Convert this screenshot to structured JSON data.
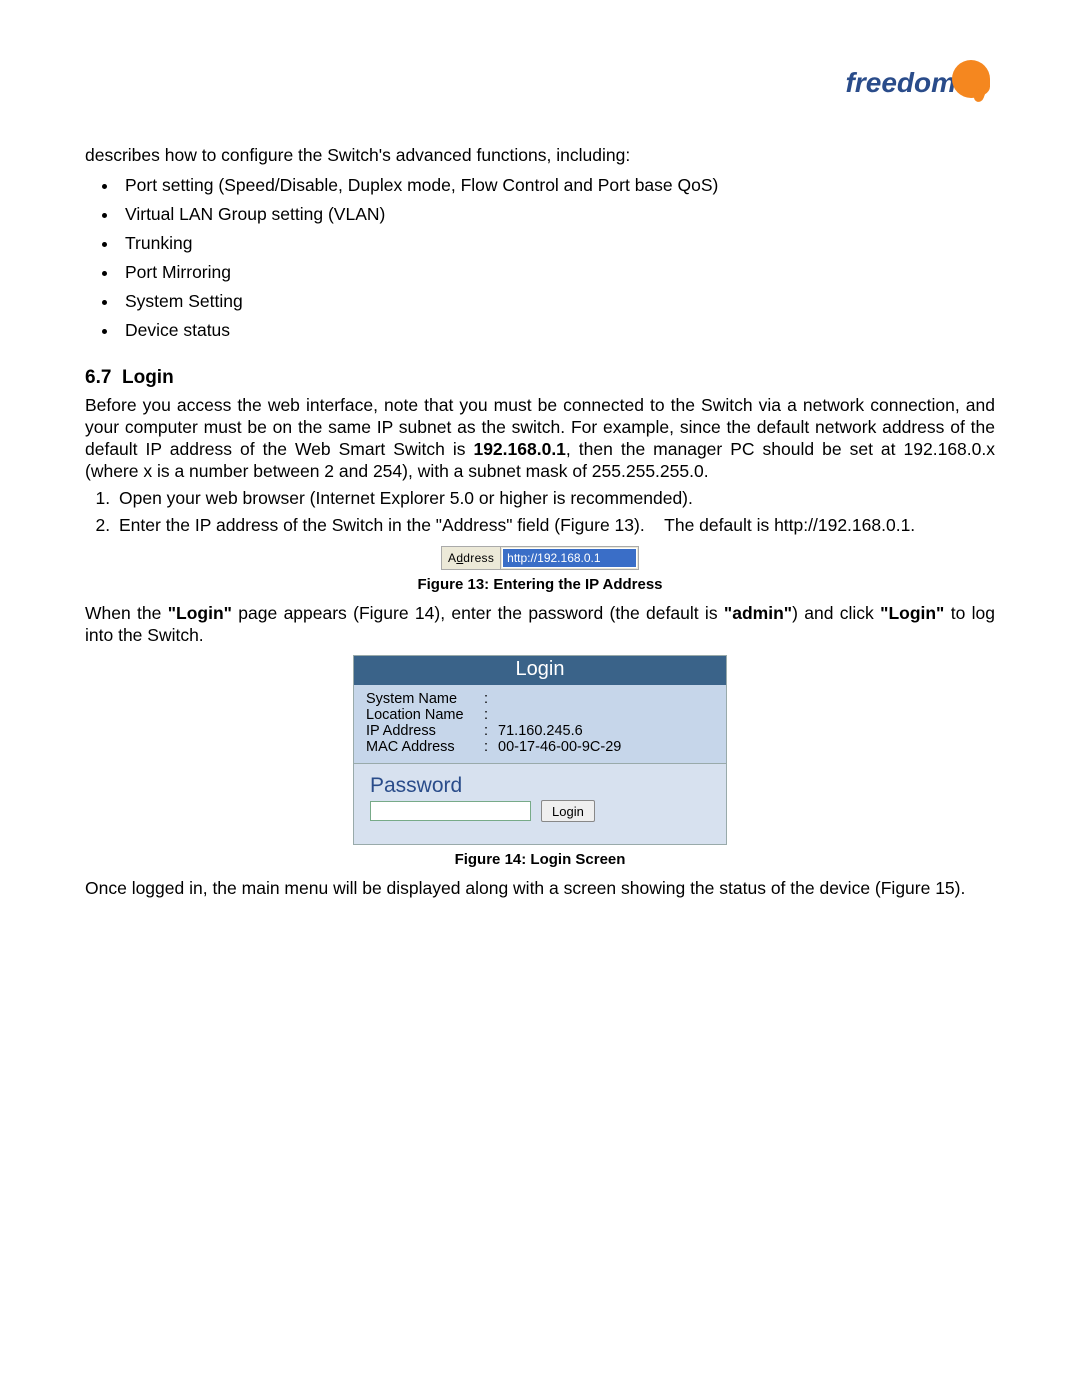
{
  "logo_text": "freedom",
  "intro": "describes how to configure the Switch's advanced functions, including:",
  "bullets": [
    "Port setting (Speed/Disable, Duplex mode, Flow Control and Port base QoS)",
    "Virtual LAN Group setting (VLAN)",
    "Trunking",
    "Port Mirroring",
    "System Setting",
    "Device status"
  ],
  "section_number": "6.7",
  "section_title": "Login",
  "para_before_ip": "Before you access the web interface, note that you must be connected to the Switch via a network connection, and your computer must be on the same IP subnet as the switch.  For example, since the default network address of the default IP address of the Web Smart Switch is ",
  "default_ip_bold": "192.168.0.1",
  "para_after_ip": ", then the manager PC should be set at 192.168.0.x (where x is a number between 2 and 254), with a subnet mask of 255.255.255.0.",
  "step1": "Open your web browser (Internet Explorer 5.0 or higher is recommended).",
  "step2a": "Enter  the  IP  address  of  the  Switch  in  the  \"Address\"  field  (Figure  13).",
  "step2b": "The  default  is http://192.168.0.1.",
  "addr_label_prefix": "A",
  "addr_label_underlined": "d",
  "addr_label_suffix": "dress",
  "addr_value": "http://192.168.0.1",
  "fig13_caption": "Figure 13: Entering the IP Address",
  "login_para_a": "When the ",
  "login_word1": "\"Login\"",
  "login_para_b": " page appears (Figure 14), enter the password (the default is ",
  "admin_word": "\"admin\"",
  "login_para_c": ") and click ",
  "login_word2": "\"Login\"",
  "login_para_d": " to log into the Switch.",
  "login_box": {
    "title": "Login",
    "rows": [
      {
        "k": "System Name",
        "v": ""
      },
      {
        "k": "Location Name",
        "v": ""
      },
      {
        "k": "IP Address",
        "v": "71.160.245.6"
      },
      {
        "k": "MAC Address",
        "v": "00-17-46-00-9C-29"
      }
    ],
    "pw_label": "Password",
    "button": "Login"
  },
  "fig14_caption": "Figure 14: Login Screen",
  "closing": "Once logged in, the main menu will be displayed along with a screen showing the status of the device (Figure 15)."
}
